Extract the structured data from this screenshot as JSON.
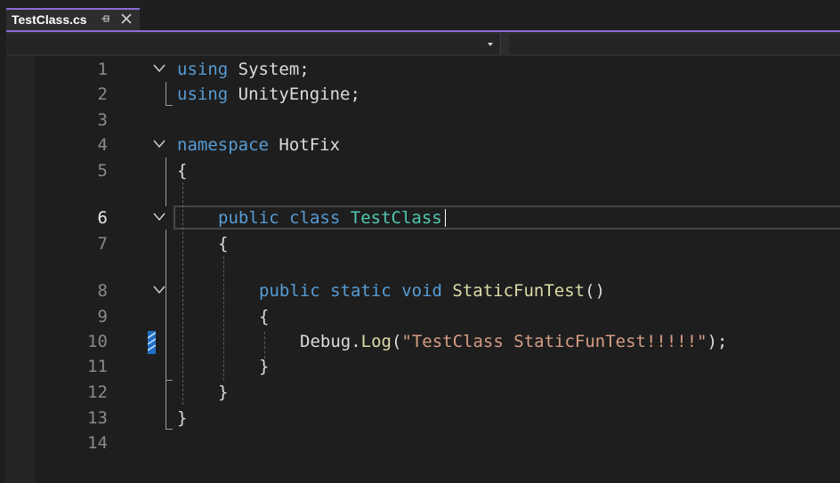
{
  "tab": {
    "title": "TestClass.cs",
    "pin_icon": "pin-icon",
    "close_icon": "close-icon"
  },
  "colors": {
    "accent": "#8d6bd8",
    "keyword": "#569cd6",
    "type": "#4ec9b0",
    "string": "#d69d85",
    "method": "#dcdcaa",
    "text": "#dcdcdc"
  },
  "editor": {
    "current_line": 6,
    "line_numbers": [
      "1",
      "2",
      "3",
      "4",
      "5",
      "6",
      "7",
      "8",
      "9",
      "10",
      "11",
      "12",
      "13",
      "14"
    ],
    "lines": {
      "l1": {
        "kw": "using",
        "rest": " System;"
      },
      "l2": {
        "kw": "using",
        "rest": " UnityEngine;"
      },
      "l4": {
        "kw": "namespace",
        "rest": " HotFix"
      },
      "l5": {
        "text": "{"
      },
      "l6": {
        "kw1": "public",
        "kw2": "class",
        "type": "TestClass"
      },
      "l7": {
        "text": "{"
      },
      "l8": {
        "kw1": "public",
        "kw2": "static",
        "kw3": "void",
        "method": "StaticFunTest",
        "paren": "()"
      },
      "l9": {
        "text": "{"
      },
      "l10": {
        "obj": "Debug.",
        "method": "Log",
        "open": "(",
        "str": "\"TestClass StaticFunTest!!!!!\"",
        "close": ");"
      },
      "l11": {
        "text": "}"
      },
      "l12": {
        "text": "}"
      },
      "l13": {
        "text": "}"
      }
    }
  }
}
